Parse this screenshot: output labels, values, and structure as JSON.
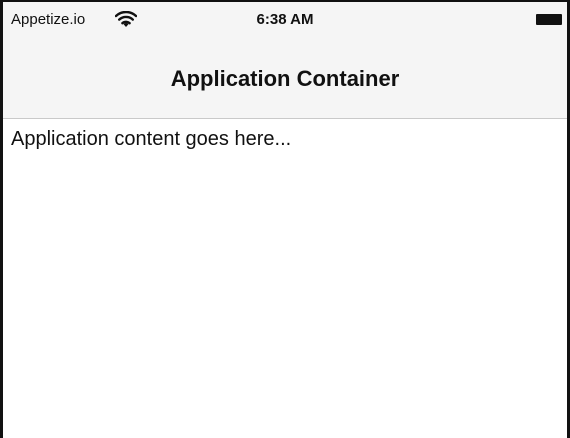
{
  "status_bar": {
    "carrier": "Appetize.io",
    "time": "6:38 AM",
    "wifi_icon": "wifi-icon",
    "battery_icon": "battery-icon"
  },
  "nav_bar": {
    "title": "Application Container"
  },
  "content": {
    "text": "Application content goes here..."
  }
}
